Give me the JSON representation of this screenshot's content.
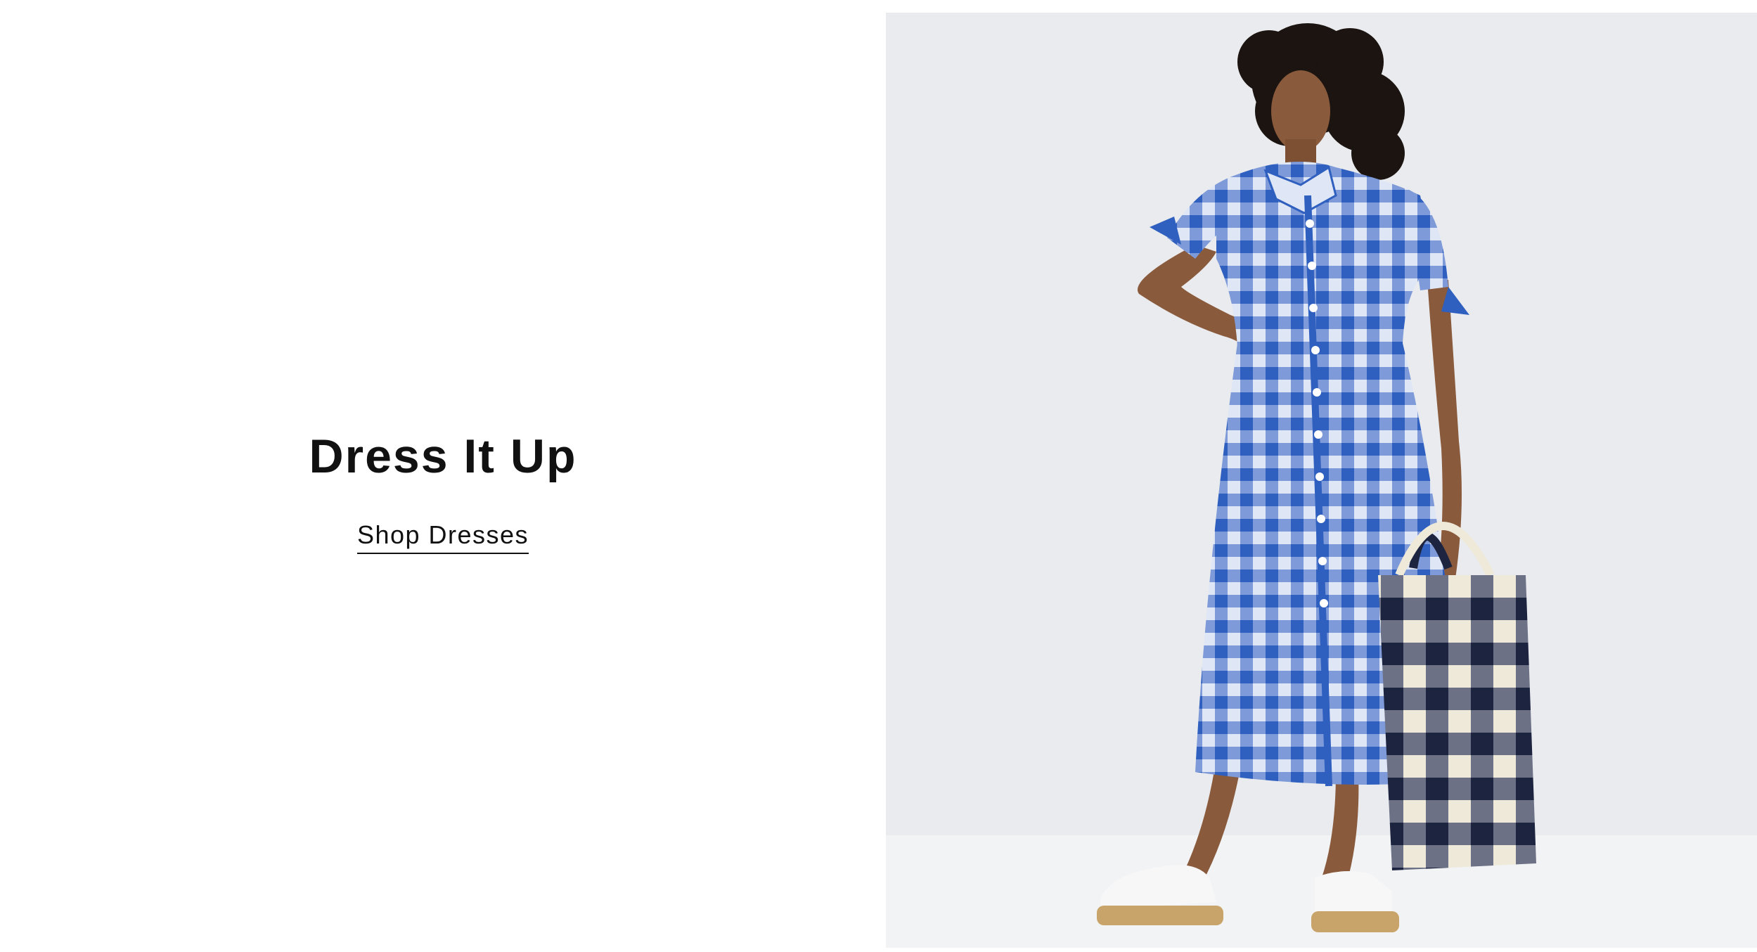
{
  "promo": {
    "headline": "Dress It Up",
    "cta_label": "Shop Dresses"
  },
  "hero_image": {
    "subject": "model-in-blue-gingham-shirt-dress-with-tote-bag",
    "colors": {
      "backdrop": "#e9ebee",
      "floor": "#f2f3f5",
      "dress_blue": "#2f5fbf",
      "dress_light": "#dfe6f5",
      "tote_navy": "#1d2440",
      "tote_cream": "#efe9da",
      "skin": "#8a5a3c",
      "hair": "#1b1410",
      "shoe": "#f7f7f7",
      "sole": "#c9a46a"
    }
  }
}
